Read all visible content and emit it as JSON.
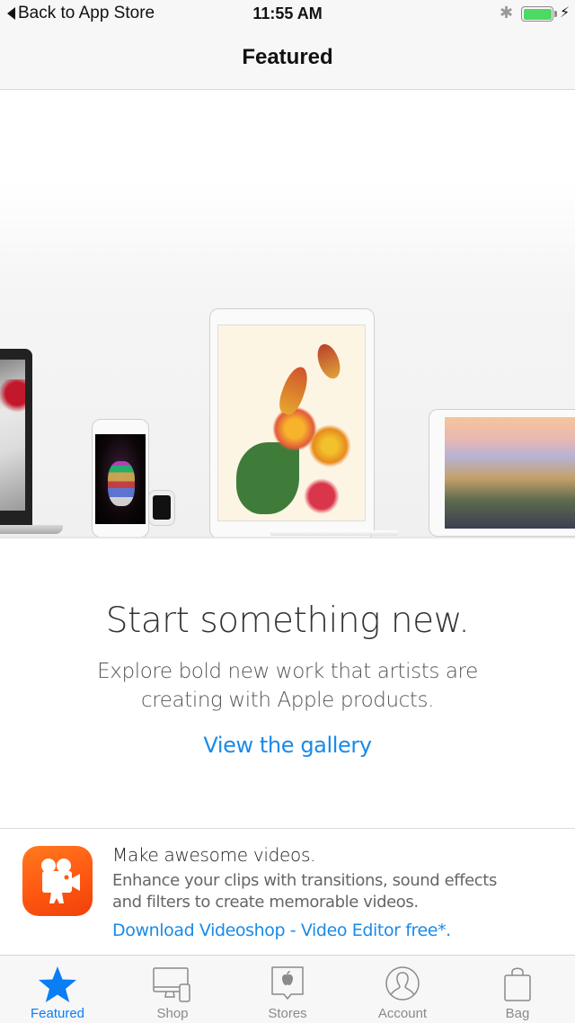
{
  "status_bar": {
    "back_label": "Back to App Store",
    "time": "11:55 AM",
    "bluetooth_icon": "bluetooth-icon",
    "battery_icon": "battery-charging-icon",
    "battery_level_percent": 100,
    "battery_color": "#4cd964"
  },
  "nav": {
    "title": "Featured"
  },
  "hero": {
    "image_description": "Apple devices (MacBook, iPhone, Apple Watch, iPad Pro with Apple Pencil, iPad) displaying artwork"
  },
  "promo": {
    "title": "Start something new.",
    "description_line1": "Explore bold new work that artists are",
    "description_line2": "creating with Apple products.",
    "link_label": "View the gallery",
    "link_color": "#1a8ae8"
  },
  "app_ad": {
    "icon": "videoshop-camera-icon",
    "title": "Make awesome videos.",
    "description_line1": "Enhance your clips with transitions, sound effects",
    "description_line2": "and filters to create memorable videos.",
    "link_label": "Download Videoshop - Video Editor free*."
  },
  "tabbar": {
    "active_color": "#0a7ef5",
    "items": [
      {
        "label": "Featured",
        "icon": "star-icon",
        "active": true
      },
      {
        "label": "Shop",
        "icon": "devices-icon",
        "active": false
      },
      {
        "label": "Stores",
        "icon": "apple-store-icon",
        "active": false
      },
      {
        "label": "Account",
        "icon": "account-icon",
        "active": false
      },
      {
        "label": "Bag",
        "icon": "bag-icon",
        "active": false
      }
    ]
  }
}
